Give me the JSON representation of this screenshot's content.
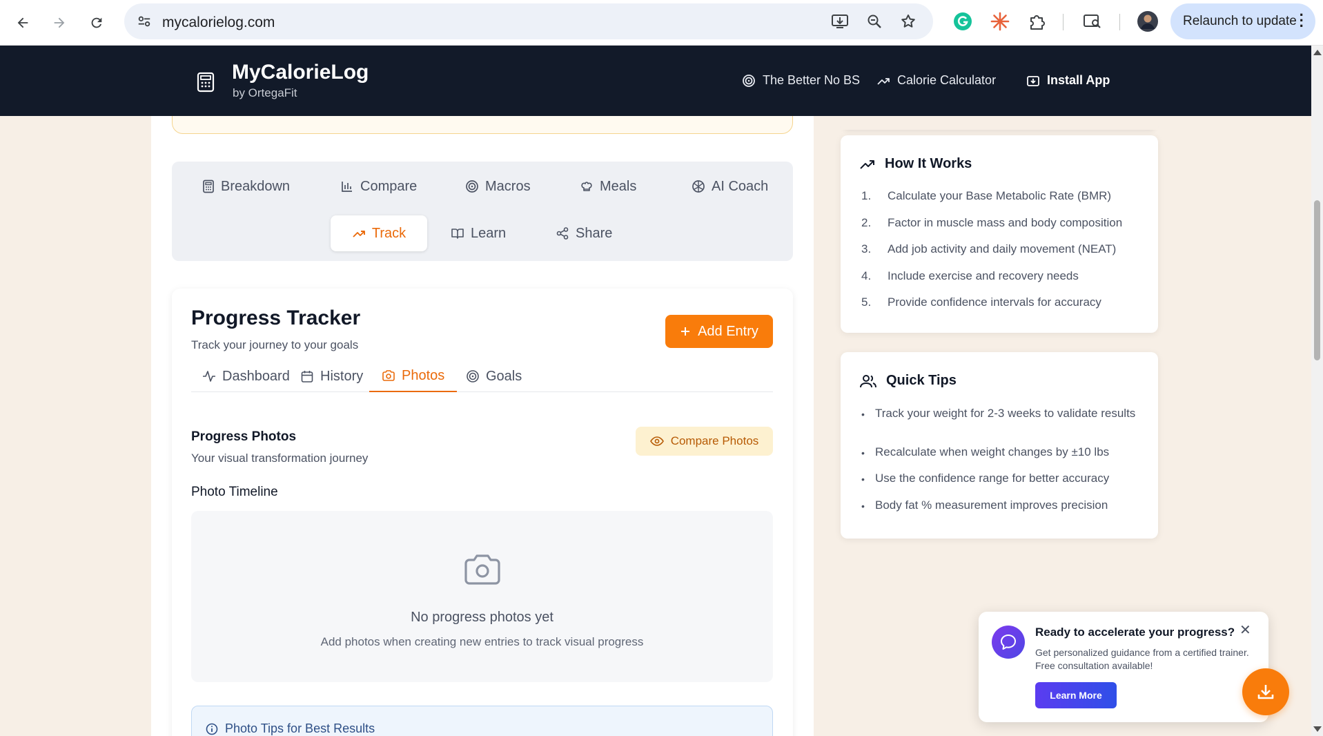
{
  "browser": {
    "url": "mycalorielog.com",
    "relaunch_label": "Relaunch to update"
  },
  "header": {
    "brand": "MyCalorieLog",
    "brand_sub": "by OrtegaFit",
    "nav": [
      {
        "label": "The Better No BS",
        "icon": "target-icon"
      },
      {
        "label": "Calorie Calculator",
        "icon": "trending-up-icon"
      },
      {
        "label": "Install App",
        "icon": "install-icon"
      }
    ]
  },
  "tabs": [
    {
      "label": "Breakdown",
      "icon": "calculator-icon"
    },
    {
      "label": "Compare",
      "icon": "bar-chart-icon"
    },
    {
      "label": "Macros",
      "icon": "target-icon"
    },
    {
      "label": "Meals",
      "icon": "chef-hat-icon"
    },
    {
      "label": "AI Coach",
      "icon": "brain-icon"
    },
    {
      "label": "Track",
      "icon": "trending-up-icon",
      "active": true
    },
    {
      "label": "Learn",
      "icon": "book-icon"
    },
    {
      "label": "Share",
      "icon": "share-icon"
    }
  ],
  "tracker": {
    "title": "Progress Tracker",
    "subtitle": "Track your journey to your goals",
    "add_entry_label": "Add Entry",
    "subtabs": [
      {
        "label": "Dashboard",
        "icon": "activity-icon"
      },
      {
        "label": "History",
        "icon": "calendar-icon"
      },
      {
        "label": "Photos",
        "icon": "camera-icon",
        "active": true
      },
      {
        "label": "Goals",
        "icon": "target-icon"
      }
    ],
    "photos": {
      "title": "Progress Photos",
      "subtitle": "Your visual transformation journey",
      "compare_label": "Compare Photos",
      "timeline_title": "Photo Timeline",
      "empty_title": "No progress photos yet",
      "empty_sub": "Add photos when creating new entries to track visual progress",
      "tips_title": "Photo Tips for Best Results"
    }
  },
  "how_it_works": {
    "title": "How It Works",
    "steps": [
      {
        "num": "1.",
        "text": "Calculate your Base Metabolic Rate (BMR)"
      },
      {
        "num": "2.",
        "text": "Factor in muscle mass and body composition"
      },
      {
        "num": "3.",
        "text": "Add job activity and daily movement (NEAT)"
      },
      {
        "num": "4.",
        "text": "Include exercise and recovery needs"
      },
      {
        "num": "5.",
        "text": "Provide confidence intervals for accuracy"
      }
    ]
  },
  "quick_tips": {
    "title": "Quick Tips",
    "tips": [
      "Track your weight for 2-3 weeks to validate results",
      "Recalculate when weight changes by ±10 lbs",
      "Use the confidence range for better accuracy",
      "Body fat % measurement improves precision"
    ]
  },
  "popup": {
    "title": "Ready to accelerate your progress?",
    "body": "Get personalized guidance from a certified trainer. Free consultation available!",
    "button": "Learn More",
    "close": "✕"
  },
  "colors": {
    "accent": "#f97c0b",
    "header_bg": "#121a29",
    "page_bg": "#f7efe6"
  }
}
